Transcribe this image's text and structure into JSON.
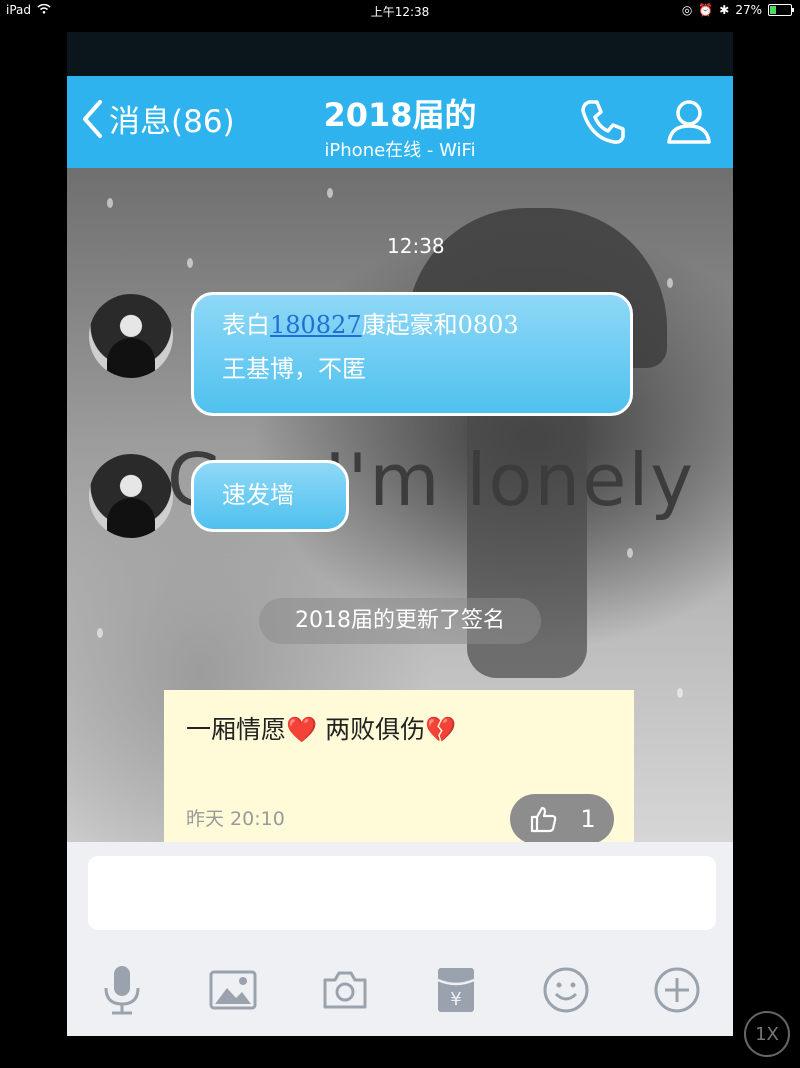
{
  "status_bar": {
    "device": "iPad",
    "time": "上午12:38",
    "battery": "27%"
  },
  "navbar": {
    "back_label": "消息(86)",
    "title": "2018届的",
    "subtitle": "iPhone在线 - WiFi"
  },
  "chat": {
    "timestamp": "12:38",
    "background_text": "G... I'm lonely",
    "messages": [
      {
        "parts": [
          "表白",
          "180827",
          "康起豪和0803",
          "王基博，不匿"
        ]
      },
      {
        "text": "速发墙"
      }
    ],
    "system_note": "2018届的更新了签名",
    "signature_card": {
      "text": "一厢情愿❤️      两败俱伤💔",
      "time": "昨天 20:10",
      "like_count": "1"
    }
  },
  "input": {
    "placeholder": ""
  },
  "toolbar": {
    "items": [
      "microphone-icon",
      "image-icon",
      "camera-icon",
      "red-packet-icon",
      "emoji-icon",
      "plus-icon"
    ]
  },
  "zoom_badge": "1X",
  "colors": {
    "navbar": "#2fb3ef",
    "bubble": "#4fc1ee",
    "card": "#fffbd9"
  }
}
